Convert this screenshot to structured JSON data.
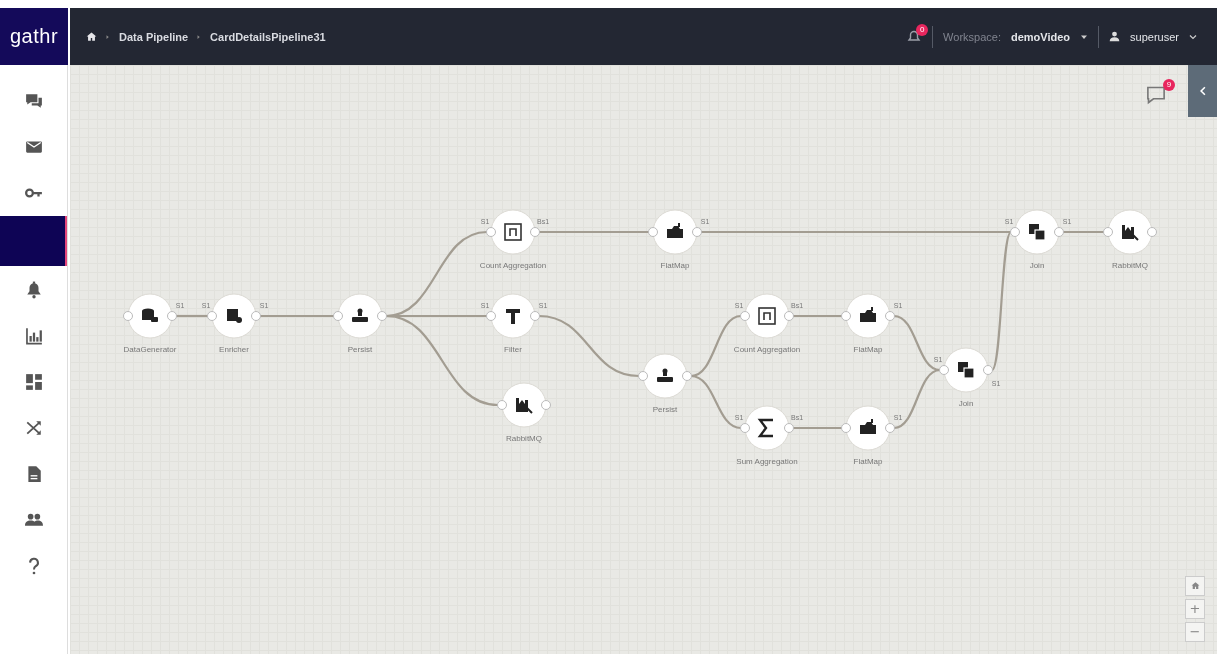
{
  "logo": "gathr",
  "breadcrumb": [
    "Data Pipeline",
    "CardDetailsPipeline31"
  ],
  "header": {
    "notification_count": "0",
    "workspace_label": "Workspace:",
    "workspace": "demoVideo",
    "user": "superuser"
  },
  "sidebar": {
    "items": [
      {
        "kind": "chat",
        "selected": false
      },
      {
        "kind": "mail",
        "selected": false
      },
      {
        "kind": "key",
        "selected": false
      },
      {
        "selected": true
      },
      {
        "kind": "bell",
        "selected": false
      },
      {
        "kind": "chart",
        "selected": false
      },
      {
        "kind": "dashboard",
        "selected": false
      },
      {
        "kind": "shuffle",
        "selected": false
      },
      {
        "kind": "document",
        "selected": false
      },
      {
        "kind": "users",
        "selected": false
      },
      {
        "kind": "help",
        "selected": false
      }
    ]
  },
  "canvas": {
    "comment_count": "9",
    "nodes": [
      {
        "label": "DataGenerator",
        "kind": "source",
        "out_port": "S1"
      },
      {
        "label": "Enricher",
        "kind": "enricher",
        "in_port": "S1",
        "out_port": "S1"
      },
      {
        "label": "Persist",
        "kind": "persist"
      },
      {
        "label": "Count Aggregation",
        "kind": "count",
        "in_port": "S1",
        "out_port": "Bs1"
      },
      {
        "label": "FlatMap",
        "kind": "flatmap",
        "out_port": "S1"
      },
      {
        "label": "Filter",
        "kind": "filter",
        "in_port": "S1",
        "out_port": "S1"
      },
      {
        "label": "RabbitMQ",
        "kind": "sink"
      },
      {
        "label": "Persist",
        "kind": "persist"
      },
      {
        "label": "Count Aggregation",
        "kind": "count",
        "in_port": "S1",
        "out_port": "Bs1"
      },
      {
        "label": "FlatMap",
        "kind": "flatmap",
        "out_port": "S1"
      },
      {
        "label": "Sum Aggregation",
        "kind": "sum",
        "in_port": "S1",
        "out_port": "Bs1"
      },
      {
        "label": "FlatMap",
        "kind": "flatmap",
        "out_port": "S1"
      },
      {
        "label": "Join",
        "kind": "join",
        "in_port": "S1",
        "out_port": "S1"
      },
      {
        "label": "Join",
        "kind": "join",
        "in_port": "S1",
        "out_port": "S1"
      },
      {
        "label": "RabbitMQ",
        "kind": "sink"
      }
    ],
    "zoom_controls": [
      "+",
      "−"
    ]
  }
}
